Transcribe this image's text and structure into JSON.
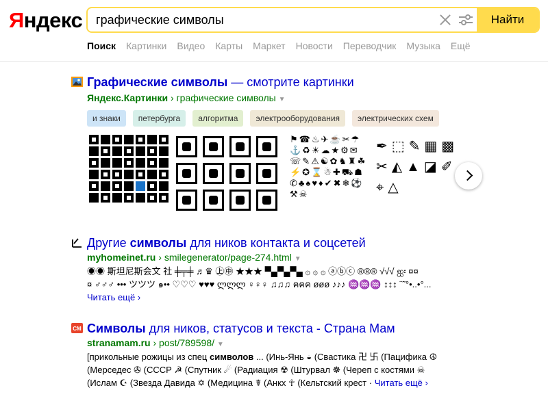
{
  "logo": {
    "first_letter": "Я",
    "rest": "ндекс"
  },
  "search": {
    "value": "графические символы",
    "button_label": "Найти"
  },
  "tabs": [
    "Поиск",
    "Картинки",
    "Видео",
    "Карты",
    "Маркет",
    "Новости",
    "Переводчик",
    "Музыка",
    "Ещё"
  ],
  "result1": {
    "title_bold": "Графические символы",
    "title_rest": " — смотрите картинки",
    "url_site": "Яндекс.Картинки",
    "url_path": "графические символы",
    "chips": [
      {
        "label": "и знаки",
        "color": "#cde4f7"
      },
      {
        "label": "петербурга",
        "color": "#d6efe9"
      },
      {
        "label": "алгоритма",
        "color": "#e2efcf"
      },
      {
        "label": "электрооборудования",
        "color": "#efe8d6"
      },
      {
        "label": "электрических схем",
        "color": "#f3e7dc"
      }
    ]
  },
  "result2": {
    "title_pre": "Другие ",
    "title_bold": "символы",
    "title_post": " для ников контакта и соцсетей",
    "url_site": "myhomeinet.ru",
    "url_path": "smilegenerator/page-274.html",
    "line1": "◉◉ 斯坦尼斯会文 社 ╪╤╪ ♬♛ ㊤㊥ ★★★ ▀▄▀▄▀▄ ۞ ۞ ۞ ⓐⓑⓒ ®®® √√√ ஐ፡ ¤¤",
    "line2": "¤ ♂♂♂ ••• ツツツ ๑•• ♡♡♡ ♥♥♥ ლლლ ♀♀♀ ♫♫♫ ฅฅฅ øøø ♪♪♪ ♒♒♒ ↕↕↕ ¨˜°•..•°...",
    "more": "Читать ещё"
  },
  "result3": {
    "title_bold": "Символы",
    "title_rest": " для ников, статусов и текста - Страна Мам",
    "url_site": "stranamam.ru",
    "url_path": "post/789598/",
    "line1_pre": "[прикольные рожицы из спец ",
    "line1_bold": "символов",
    "line1_post": " ... (Инь-Янь ◒ (Свастика 卍 卐 (Пацифика ☮",
    "line2": "(Мерседес ✇ (СССР ☭ (Спутник ☄ (Радиация ☢ (Штурвал ☸ (Череп с костями ☠",
    "line3": "(Ислам ☪ (Звезда Давида ✡ (Медицина ☤ (Анкх ☥ (Кельтский крест ·",
    "more": "Читать ещё"
  },
  "colors": {
    "accent": "#ffdb4d",
    "link": "#0000cc",
    "url_green": "#007700"
  }
}
